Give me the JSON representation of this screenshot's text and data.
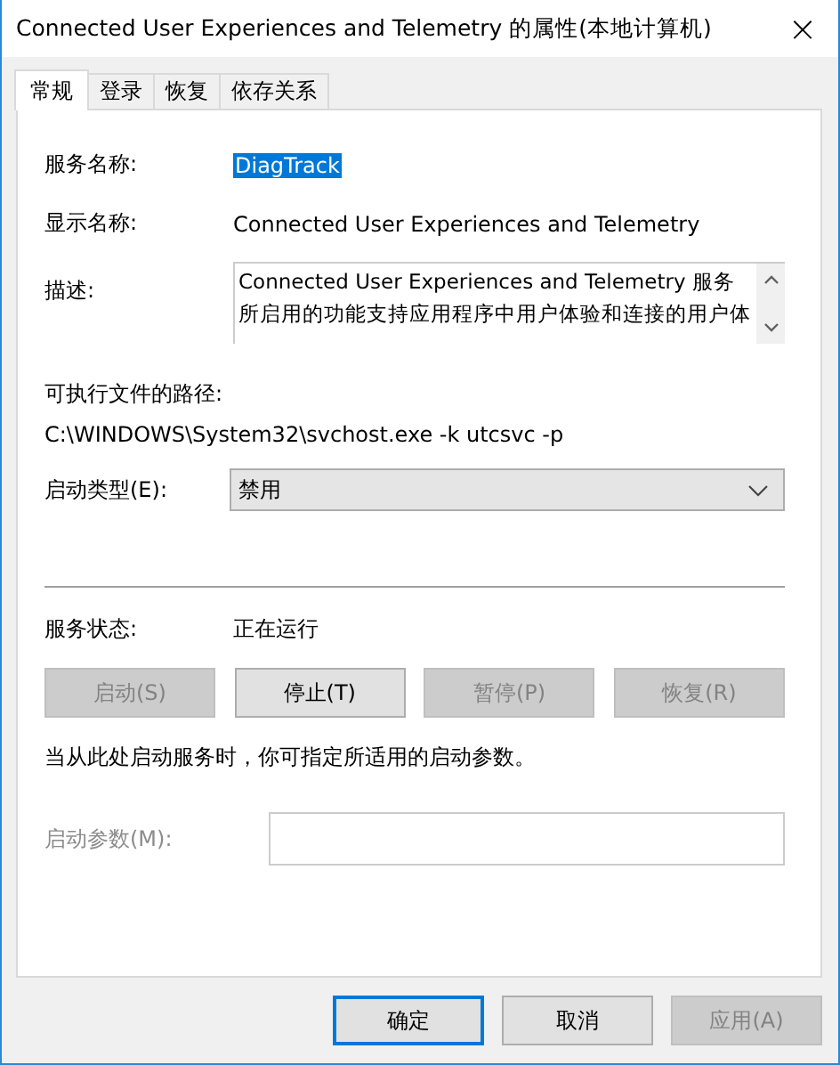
{
  "window": {
    "title": "Connected User Experiences and Telemetry 的属性(本地计算机)",
    "close": "×"
  },
  "tabs": [
    {
      "label": "常规",
      "selected": true
    },
    {
      "label": "登录",
      "selected": false
    },
    {
      "label": "恢复",
      "selected": false
    },
    {
      "label": "依存关系",
      "selected": false
    }
  ],
  "service_name": {
    "label": "服务名称:",
    "value": "DiagTrack",
    "selected": true
  },
  "display_name": {
    "label": "显示名称:",
    "value": "Connected User Experiences and Telemetry"
  },
  "description": {
    "label": "描述:",
    "value": "Connected User Experiences and Telemetry 服务所启用的功能支持应用程序中用户体验和连接的用户体"
  },
  "executable_path": {
    "label": "可执行文件的路径:",
    "value": "C:\\WINDOWS\\System32\\svchost.exe -k utcsvc -p"
  },
  "startup_type": {
    "label": "启动类型(E):",
    "value": "禁用"
  },
  "service_status": {
    "label": "服务状态:",
    "value": "正在运行"
  },
  "service_buttons": [
    {
      "label": "启动(S)",
      "disabled": true
    },
    {
      "label": "停止(T)",
      "disabled": false
    },
    {
      "label": "暂停(P)",
      "disabled": true
    },
    {
      "label": "恢复(R)",
      "disabled": true
    }
  ],
  "hint": "当从此处启动服务时，你可指定所适用的启动参数。",
  "start_parameters": {
    "label": "启动参数(M):",
    "disabled": true
  },
  "dialog_buttons": [
    {
      "label": "确定",
      "disabled": false,
      "default": true
    },
    {
      "label": "取消",
      "disabled": false,
      "default": false
    },
    {
      "label": "应用(A)",
      "disabled": true,
      "default": false
    }
  ]
}
